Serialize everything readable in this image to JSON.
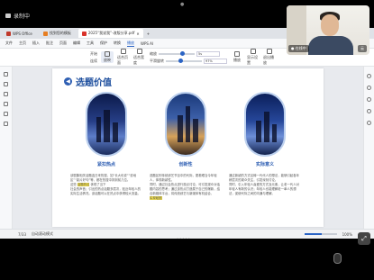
{
  "recording": {
    "label": "录制中"
  },
  "webcam": {
    "name_tag": "● 在线中",
    "right_tag": "云"
  },
  "tabs": [
    {
      "label": "WPS Office",
      "color": "#c0392b"
    },
    {
      "label": "找到您的模板",
      "color": "#e67e22"
    },
    {
      "label": "2025“我说我”-改版分享.pdf",
      "color": "#d9332b"
    }
  ],
  "menu": {
    "items": [
      "文件",
      "主页",
      "插入",
      "批注",
      "页面",
      "编辑",
      "工具",
      "保护",
      "转换",
      "播放",
      "WPS AI"
    ],
    "active": "播放",
    "right": [
      "分享",
      "有问题"
    ]
  },
  "toolbar": {
    "items": [
      "开始",
      "连续",
      "放映",
      "适合页面",
      "适合宽度"
    ],
    "row1_label": "缩放",
    "row2_label": "平滑旋转",
    "zoom_value": "97%",
    "speed_value": "5s",
    "right": [
      "播放",
      "显示设置",
      "退出播放"
    ],
    "slider1_pct": 0.6,
    "slider2_pct": 0.35
  },
  "document": {
    "title": "选题价值",
    "columns": [
      {
        "heading": "紧扣热点",
        "lines": [
          "该剧集相关话题连日来热搜，如“长大也说”“说地区”“影片好句”等，都在热搜中排到前几位。",
          "这些",
          "体现了当下",
          "社会的声音；引出的热点话题多层次，贴近年轻人的实际生活情况。该话题可以在热点中获得较大流量。"
        ],
        "highlight": "话题热议"
      },
      {
        "heading": "创新性",
        "lines": [
          "选题区别传统综艺节目中的代际，更着眼当今年轻人，体现新颖性。",
          "同时，通过社会热点进行观点讨论，可引发观众对话题内容的思考；通过该热点打造属于自己的爆款，结合新媒体平台，将传统综艺与新媒体有机结合，",
          "实现破圈"
        ],
        "highlight": "实现破圈"
      },
      {
        "heading": "实际意义",
        "lines": [
          "通过新颖的方式诠释一代代人的想法，能够引起各年龄层次的观众关注，引发深刻讨论。",
          "同时，引入年轻人喜爱的方式及元素，让老一代人对年轻人有新的认识；年轻人也能理解老一辈人的想法，促使代际之间的沟通与理解。"
        ],
        "highlight": ""
      }
    ]
  },
  "status": {
    "page": "7/33",
    "view_label": "自动滚动模式",
    "zoom": "100%",
    "progress_pct": 0.55
  },
  "pager_text": "• • • • •"
}
